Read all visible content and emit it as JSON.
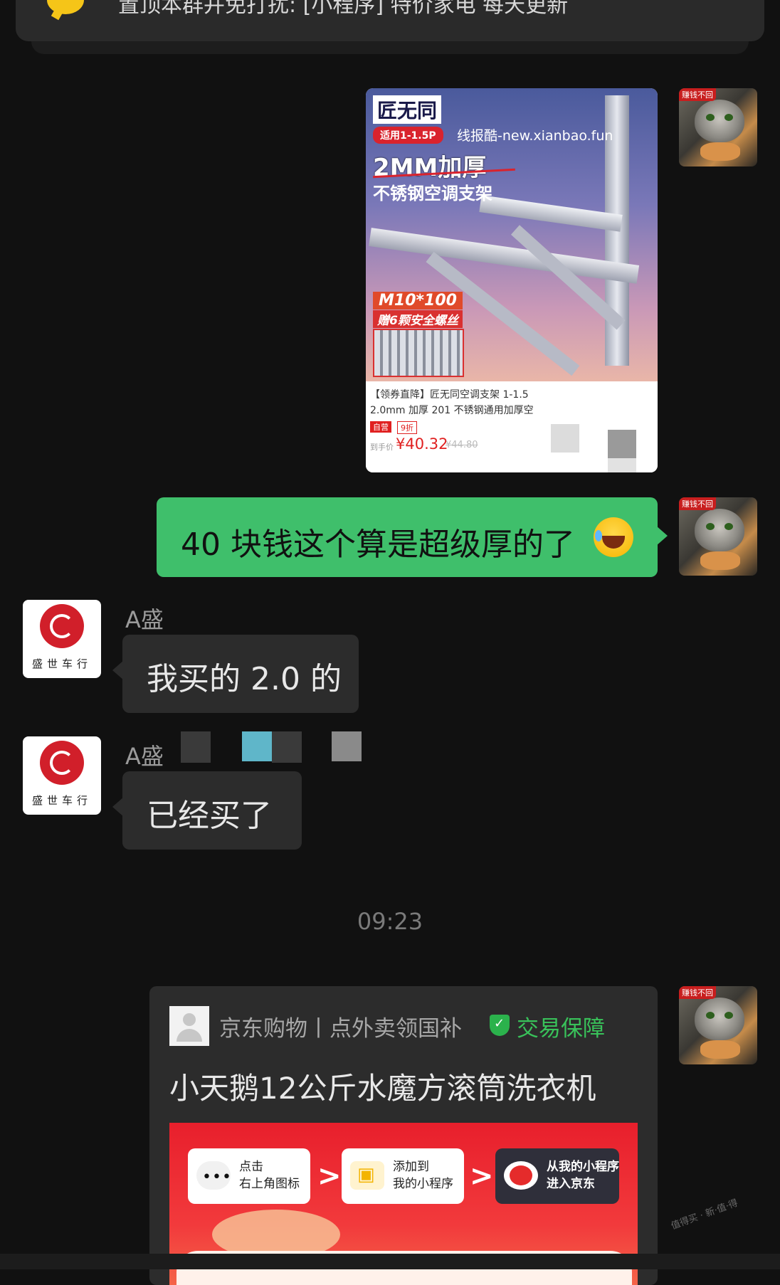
{
  "notice": {
    "text": "置顶本群并免打扰: [小程序] 特价家电 每天更新",
    "icon": "chat-bubble-icon",
    "icon_color": "#f5c518"
  },
  "messages": {
    "product_image": {
      "brand": "匠无同",
      "fit_label": "适用1-1.5P",
      "watermark": "线报酷-new.xianbao.fun",
      "headline": "2MM加厚",
      "subheadline": "不锈钢空调支架",
      "bolt_spec": "M10*100",
      "bolt_gift": "赠6颗安全螺丝",
      "desc_line1": "【领券直降】匠无同空调支架 1-1.5",
      "desc_line2": "2.0mm 加厚 201 不锈钢通用加厚空",
      "tag_self": "自营",
      "tag_discount": "9折",
      "price_label": "到手价",
      "price": "¥40.32",
      "price_old": "¥44.80"
    },
    "self_text": "40 块钱这个算是超级厚的了",
    "self_avatar_tag": "赚钱不回",
    "reply1": {
      "sender": "A盛",
      "text": "我买的 2.0 的"
    },
    "reply2": {
      "sender": "A盛",
      "text": "已经买了"
    },
    "other_avatar_text": "盛世车行",
    "timestamp": "09:23",
    "mini_program": {
      "source": "京东购物丨点外卖领国补",
      "guarantee": "交易保障",
      "title": "小天鹅12公斤水魔方滚筒洗衣机",
      "step1": [
        "点击",
        "右上角图标"
      ],
      "step2": [
        "添加到",
        "我的小程序"
      ],
      "step3": [
        "从我的小程序",
        "进入京东"
      ],
      "arrow": ">",
      "dots": "•••"
    }
  },
  "corner_watermark": "值得买 · 新·值·得",
  "colors": {
    "background": "#111111",
    "self_bubble": "#3fbf6b",
    "other_bubble": "#2c2c2c",
    "guarantee_green": "#39c25a",
    "banner_red": "#e81f2c"
  }
}
